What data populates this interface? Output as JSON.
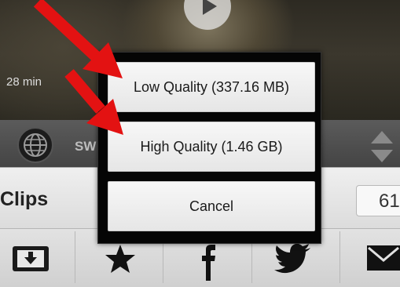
{
  "video": {
    "duration": "28 min"
  },
  "info_bar": {
    "partial_text": "SW"
  },
  "clips": {
    "label": "Clips",
    "count": "61"
  },
  "dialog": {
    "options": [
      {
        "label": "Low Quality (337.16 MB)"
      },
      {
        "label": "High Quality (1.46 GB)"
      }
    ],
    "cancel_label": "Cancel"
  },
  "action_bar": {
    "icons": [
      "download-icon",
      "star-icon",
      "facebook-icon",
      "twitter-icon",
      "mail-icon"
    ]
  },
  "annotation": {
    "arrow_color": "#e31212"
  }
}
